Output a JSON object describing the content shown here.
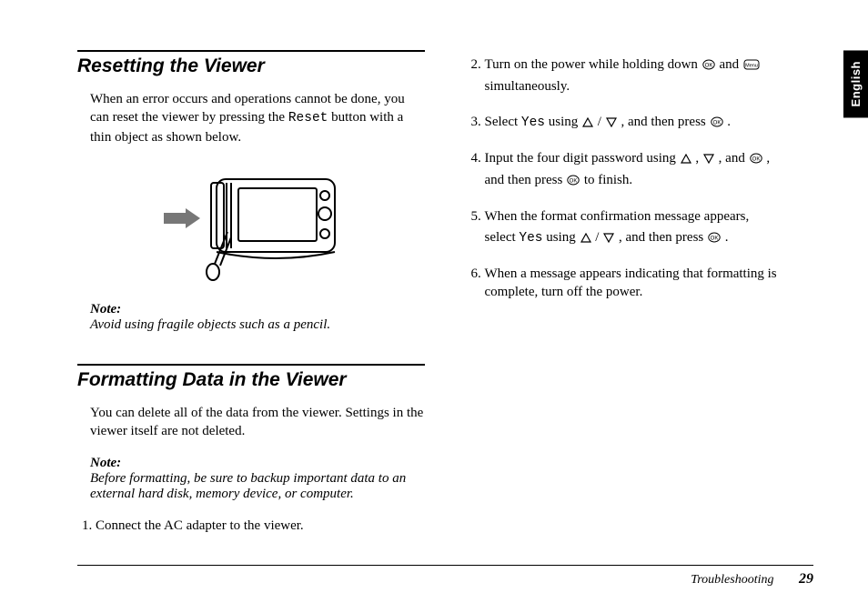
{
  "langTab": "English",
  "left": {
    "reset": {
      "title": "Resetting the Viewer",
      "intro": {
        "a": "When an error occurs and operations cannot be done, you can reset the viewer by pressing the ",
        "reset": "Reset",
        "b": " button with a thin object as shown below."
      },
      "noteLabel": "Note:",
      "noteText": "Avoid using fragile objects such as a pencil."
    },
    "format": {
      "title": "Formatting Data in the Viewer",
      "intro": "You can delete all of the data from the viewer. Settings in the viewer itself are not deleted.",
      "noteLabel": "Note:",
      "noteText": "Before formatting, be sure to backup important data to an external hard disk, memory device, or computer."
    }
  },
  "steps": {
    "0": {
      "full": "Connect the AC adapter to the viewer."
    },
    "1": {
      "a": "Turn on the power while holding down ",
      "b": " and ",
      "c": "simultaneously."
    },
    "2": {
      "a": "Select ",
      "yes": "Yes",
      "b": " using ",
      "c": " / ",
      "d": " , and then press ",
      "e": " ."
    },
    "3": {
      "a": "Input the four digit password using ",
      "b": " , ",
      "c": " , and ",
      "d": " ,",
      "e": "and then press ",
      "f": " to finish."
    },
    "4": {
      "a": "When the format confirmation message appears,",
      "b": "select ",
      "yes": "Yes",
      "c": " using ",
      "d": " / ",
      "e": " , and then press ",
      "f": " ."
    },
    "5": {
      "full": "When a message appears indicating that formatting is complete, turn off the power."
    }
  },
  "footer": {
    "section": "Troubleshooting",
    "page": "29"
  }
}
